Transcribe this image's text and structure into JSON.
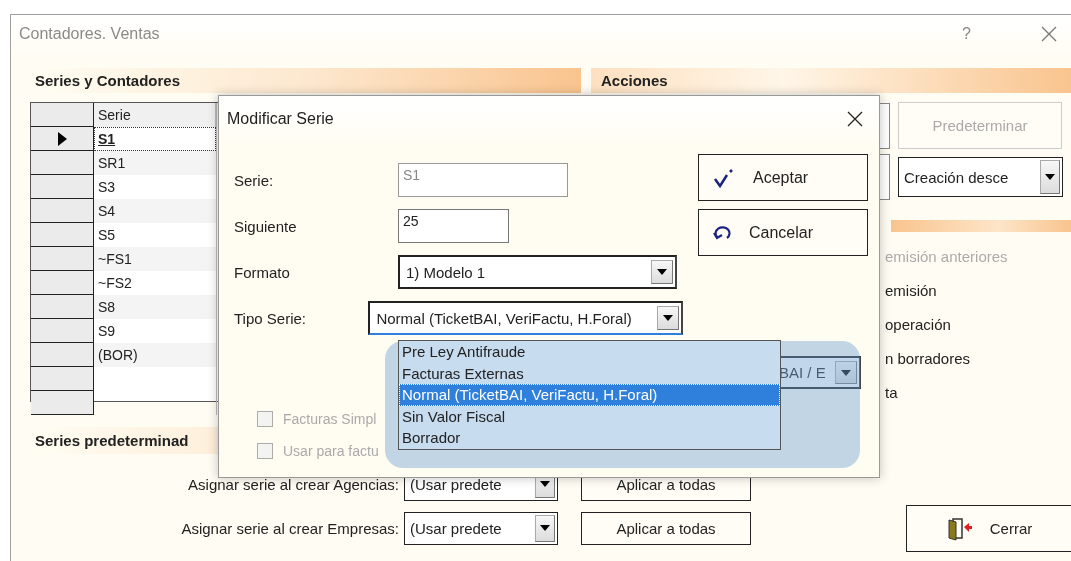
{
  "window": {
    "title": "Contadores. Ventas",
    "help": "?"
  },
  "series_panel": {
    "title": "Series y Contadores",
    "columns": [
      "Serie"
    ],
    "rows": [
      {
        "serie": "S1",
        "current": true
      },
      {
        "serie": "SR1",
        "current": false
      },
      {
        "serie": "S3",
        "current": false
      },
      {
        "serie": "S4",
        "current": false
      },
      {
        "serie": "S5",
        "current": false
      },
      {
        "serie": "~FS1",
        "current": false
      },
      {
        "serie": "~FS2",
        "current": false
      },
      {
        "serie": "S8",
        "current": false
      },
      {
        "serie": "S9",
        "current": false
      },
      {
        "serie": "(BOR)",
        "current": false
      },
      {
        "serie": "",
        "current": false
      },
      {
        "serie": "",
        "current": false
      }
    ]
  },
  "actions_panel": {
    "title": "Acciones",
    "default_button": {
      "label": "Predeterminar",
      "disabled": true
    },
    "order_combo": "Creación desce",
    "options": [
      {
        "label": "emisión anteriores",
        "disabled": true
      },
      {
        "label": "emisión",
        "disabled": false
      },
      {
        "label": "operación",
        "disabled": false
      },
      {
        "label": "n borradores",
        "disabled": false
      },
      {
        "label": "ta",
        "disabled": false
      }
    ]
  },
  "defaults_panel": {
    "title": "Series predeterminad",
    "rows": [
      {
        "label": "Asignar serie al crear Agencias:",
        "value": "(Usar predete",
        "button": "Aplicar a todas"
      },
      {
        "label": "Asignar serie al crear Empresas:",
        "value": "(Usar predete",
        "button": "Aplicar a todas"
      }
    ]
  },
  "close_button": "Cerrar",
  "dialog": {
    "title": "Modificar Serie",
    "fields": [
      {
        "kind": "text",
        "label": "Serie:",
        "value": "S1",
        "disabled": true
      },
      {
        "kind": "text",
        "label": "Siguiente",
        "value": "25",
        "disabled": false
      },
      {
        "kind": "combo",
        "label": "Formato",
        "value": "1) Modelo 1",
        "expanded": false
      },
      {
        "kind": "combo",
        "label": "Tipo Serie:",
        "value": "Normal (TicketBAI, VeriFactu, H.Foral)",
        "expanded": true
      }
    ],
    "dropdown_options": [
      {
        "label": "Pre Ley Antifraude",
        "selected": false
      },
      {
        "label": "Facturas Externas",
        "selected": false
      },
      {
        "label": "Normal (TicketBAI, VeriFactu, H.Foral)",
        "selected": true
      },
      {
        "label": "Sin Valor Fiscal",
        "selected": false
      },
      {
        "label": "Borrador",
        "selected": false
      }
    ],
    "hidden_combo": "BAI / E",
    "checkboxes": [
      {
        "label": "Facturas Simpl",
        "checked": false,
        "disabled": true
      },
      {
        "label": "Usar para factu",
        "checked": false,
        "disabled": true
      }
    ],
    "buttons": [
      {
        "kind": "accept",
        "label": "Aceptar"
      },
      {
        "kind": "cancel",
        "label": "Cancelar"
      }
    ]
  }
}
